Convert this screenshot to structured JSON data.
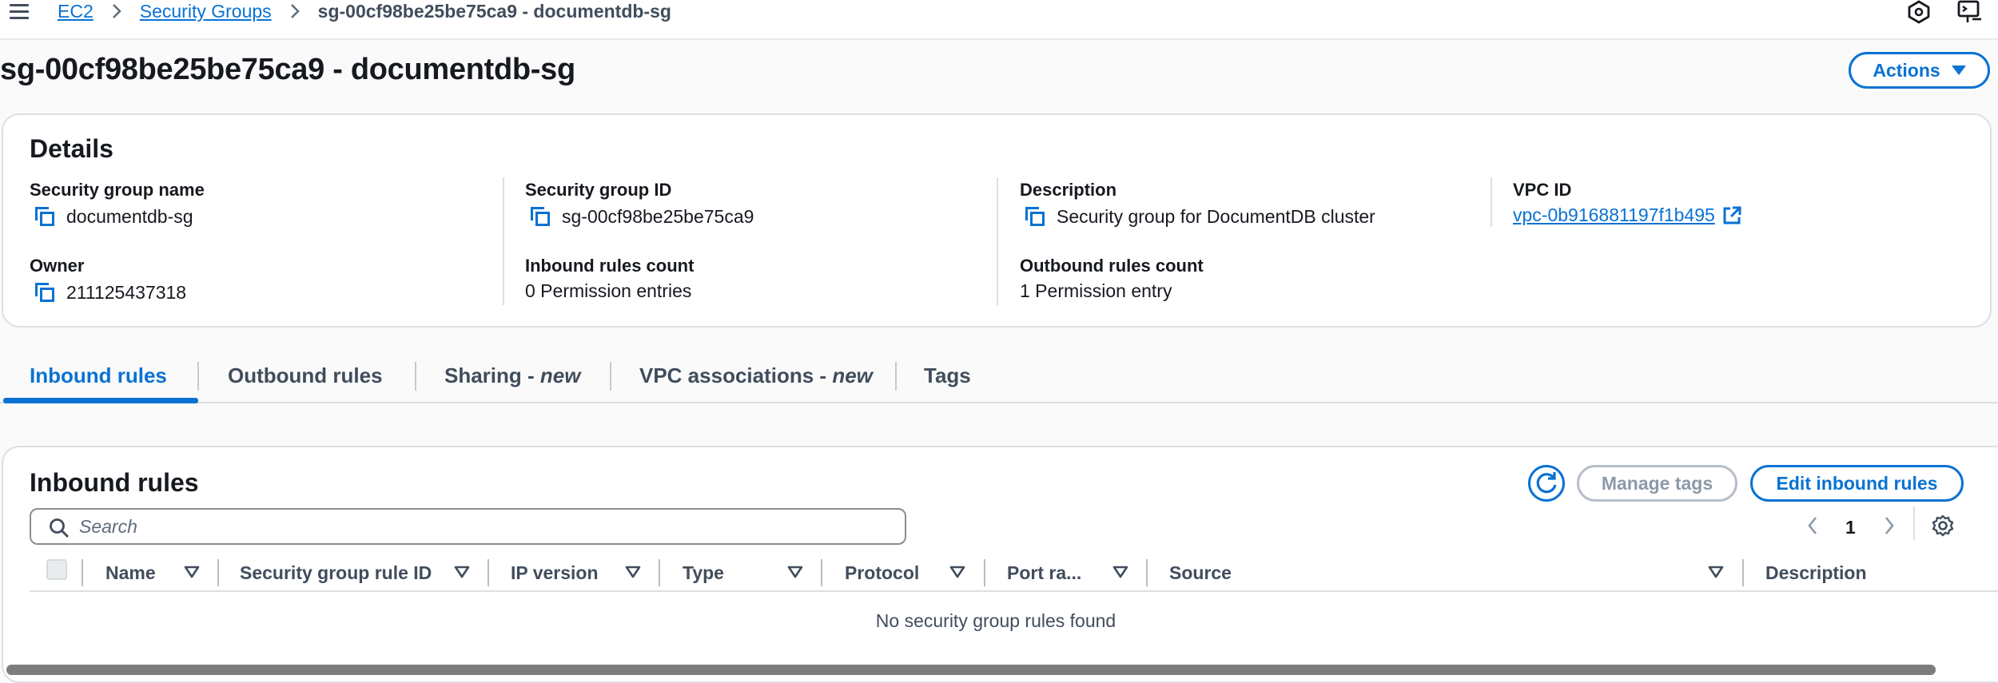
{
  "breadcrumb": {
    "items": [
      "EC2",
      "Security Groups"
    ],
    "current": "sg-00cf98be25be75ca9 - documentdb-sg"
  },
  "header": {
    "title": "sg-00cf98be25be75ca9 - documentdb-sg",
    "actions_label": "Actions"
  },
  "details": {
    "title": "Details",
    "fields": {
      "sg_name": {
        "label": "Security group name",
        "value": "documentdb-sg"
      },
      "sg_id": {
        "label": "Security group ID",
        "value": "sg-00cf98be25be75ca9"
      },
      "description": {
        "label": "Description",
        "value": "Security group for DocumentDB cluster"
      },
      "vpc_id": {
        "label": "VPC ID",
        "value": "vpc-0b916881197f1b495"
      },
      "owner": {
        "label": "Owner",
        "value": "211125437318"
      },
      "inbound_count": {
        "label": "Inbound rules count",
        "value": "0 Permission entries"
      },
      "outbound_count": {
        "label": "Outbound rules count",
        "value": "1 Permission entry"
      }
    }
  },
  "tabs": [
    {
      "label": "Inbound rules",
      "suffix": ""
    },
    {
      "label": "Outbound rules",
      "suffix": ""
    },
    {
      "label": "Sharing - ",
      "suffix": "new"
    },
    {
      "label": "VPC associations - ",
      "suffix": "new"
    },
    {
      "label": "Tags",
      "suffix": ""
    }
  ],
  "inbound": {
    "title": "Inbound rules",
    "manage_tags_label": "Manage tags",
    "edit_label": "Edit inbound rules",
    "search_placeholder": "Search",
    "page_number": "1",
    "columns": [
      "Name",
      "Security group rule ID",
      "IP version",
      "Type",
      "Protocol",
      "Port ra...",
      "Source",
      "Description"
    ],
    "empty_message": "No security group rules found"
  },
  "colors": {
    "accent": "#0972d3",
    "text": "#16191f",
    "border": "#dcdfe3"
  },
  "icons": [
    "menu-icon",
    "chevron-right-icon",
    "notifications-icon",
    "cloudshell-icon",
    "caret-down-icon",
    "copy-icon",
    "external-link-icon",
    "refresh-icon",
    "search-icon",
    "chevron-left-icon",
    "settings-icon",
    "sort-icon"
  ]
}
